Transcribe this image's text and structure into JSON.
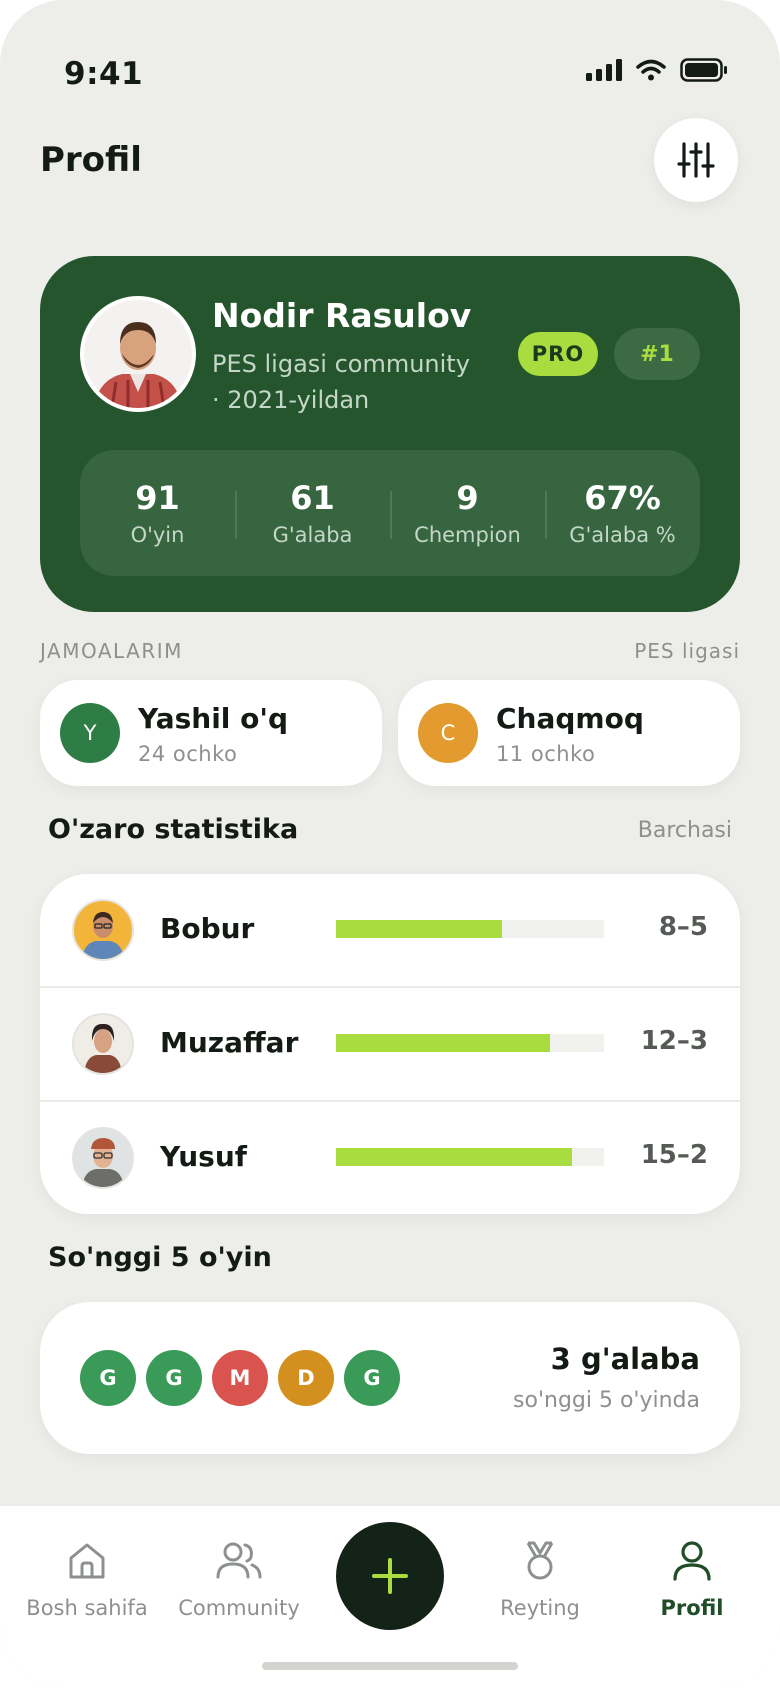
{
  "status_bar": {
    "time": "9:41"
  },
  "header": {
    "title": "Profil",
    "filter_icon": "sliders-icon"
  },
  "profile": {
    "name": "Nodir Rasulov",
    "subtitle": "PES ligasi community · 2021-yildan",
    "badge": "PRO",
    "rank": "#1",
    "stats": [
      {
        "value": "91",
        "label": "O'yin"
      },
      {
        "value": "61",
        "label": "G'alaba"
      },
      {
        "value": "9",
        "label": "Chempion"
      },
      {
        "value": "67%",
        "label": "G'alaba %"
      }
    ]
  },
  "teams_section": {
    "title": "JAMOALARIM",
    "league": "PES ligasi",
    "teams": [
      {
        "initial": "Y",
        "name": "Yashil o'q",
        "points": "24 ochko",
        "color": "#2e7d46"
      },
      {
        "initial": "C",
        "name": "Chaqmoq",
        "points": "11 ochko",
        "color": "#e39a2e"
      }
    ]
  },
  "h2h": {
    "title": "O'zaro statistika",
    "link": "Barchasi",
    "rows": [
      {
        "name": "Bobur",
        "score": "8–5",
        "win_fraction": 0.62
      },
      {
        "name": "Muzaffar",
        "score": "12–3",
        "win_fraction": 0.8
      },
      {
        "name": "Yusuf",
        "score": "15–2",
        "win_fraction": 0.88
      }
    ]
  },
  "recent": {
    "title": "So'nggi 5 o'yin",
    "results": [
      {
        "letter": "G",
        "color": "#3a9a57"
      },
      {
        "letter": "G",
        "color": "#3a9a57"
      },
      {
        "letter": "M",
        "color": "#d9534f"
      },
      {
        "letter": "D",
        "color": "#d4901f"
      },
      {
        "letter": "G",
        "color": "#3a9a57"
      }
    ],
    "summary": "3 g'alaba",
    "summary_sub": "so'nggi 5 o'yinda"
  },
  "tabbar": {
    "tabs": [
      {
        "label": "Bosh sahifa",
        "icon": "home-icon"
      },
      {
        "label": "Community",
        "icon": "users-icon"
      },
      {
        "label": "Reyting",
        "icon": "medal-icon"
      },
      {
        "label": "Profil",
        "icon": "user-icon",
        "active": true
      }
    ],
    "fab_icon": "plus-icon"
  },
  "colors": {
    "brand_green": "#24552d",
    "accent_lime": "#a9dc3f",
    "background": "#ededea"
  }
}
